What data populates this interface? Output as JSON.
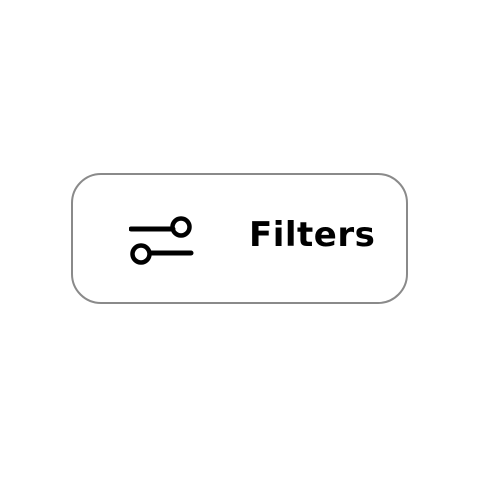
{
  "filter_button": {
    "label": "Filters",
    "icon": "sliders-icon"
  },
  "colors": {
    "background": "#ffffff",
    "border": "#8a8a8a",
    "text": "#000000",
    "icon": "#000000"
  }
}
